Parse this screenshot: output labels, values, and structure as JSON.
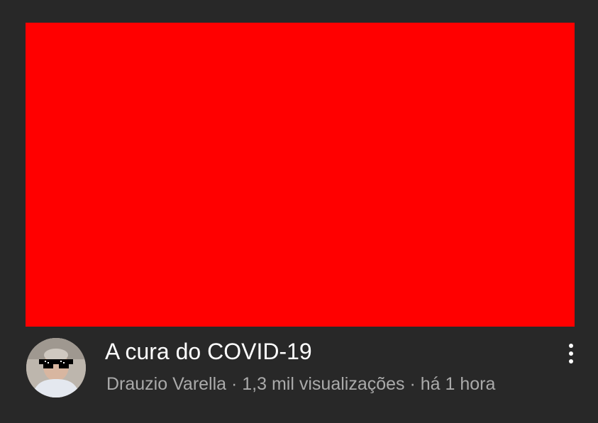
{
  "video": {
    "title": "A cura do COVID-19",
    "channel": "Drauzio Varella",
    "separator": " · ",
    "views": "1,3 mil visualizações",
    "age": "há 1 hora",
    "thumbnail_color": "#ff0000"
  },
  "icons": {
    "menu": "more-vertical-icon",
    "avatar": "channel-avatar"
  },
  "colors": {
    "background": "#282828",
    "title": "#ffffff",
    "meta": "#aaaaaa"
  }
}
